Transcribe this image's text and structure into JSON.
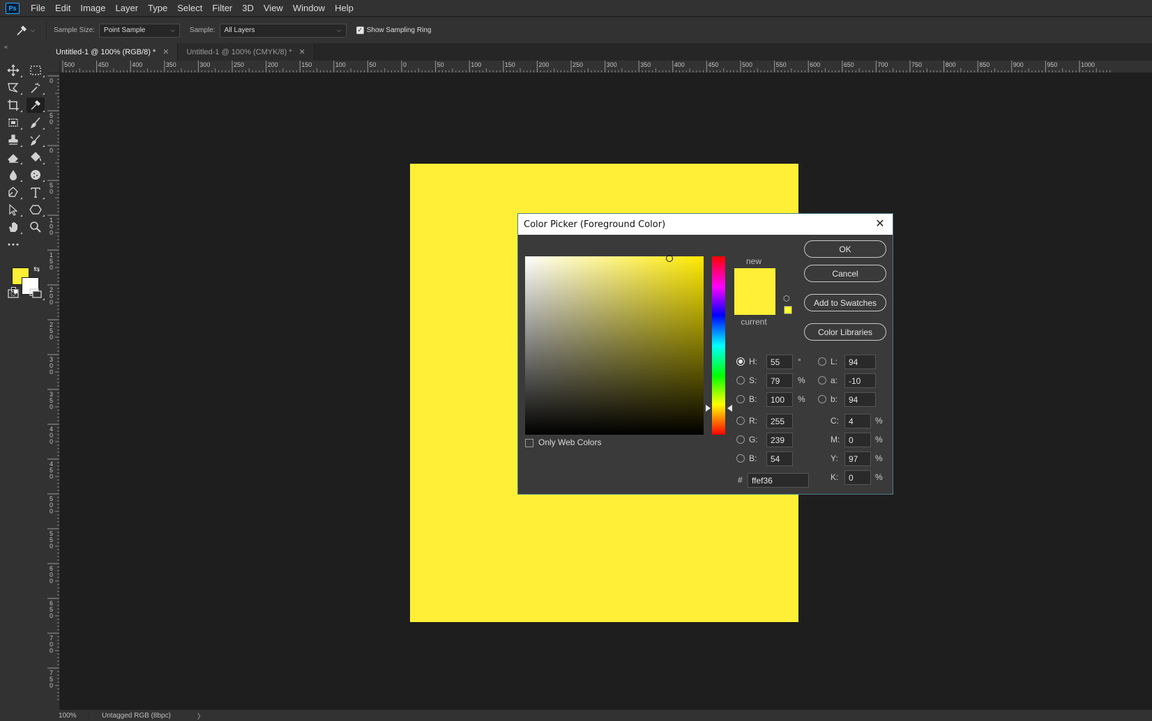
{
  "app": {
    "logo": "Ps"
  },
  "menu": [
    "File",
    "Edit",
    "Image",
    "Layer",
    "Type",
    "Select",
    "Filter",
    "3D",
    "View",
    "Window",
    "Help"
  ],
  "options": {
    "sample_size_label": "Sample Size:",
    "sample_size_value": "Point Sample",
    "sample_label": "Sample:",
    "sample_value": "All Layers",
    "show_ring_label": "Show Sampling Ring",
    "show_ring_checked": true
  },
  "tabs": [
    {
      "label": "Untitled-1 @ 100% (RGB/8) *",
      "active": true
    },
    {
      "label": "Untitled-1 @ 100% (CMYK/8) *",
      "active": false
    }
  ],
  "ruler_top": [
    "500",
    "450",
    "400",
    "350",
    "300",
    "250",
    "200",
    "150",
    "100",
    "50",
    "0",
    "50",
    "100",
    "150",
    "200",
    "250",
    "300",
    "350",
    "400",
    "450",
    "500",
    "550",
    "600",
    "650",
    "700",
    "750",
    "800",
    "850",
    "900",
    "950",
    "1000"
  ],
  "ruler_left": [
    "0",
    "50",
    "0",
    "50",
    "100",
    "150",
    "200",
    "250",
    "300",
    "350",
    "400",
    "450",
    "500",
    "550",
    "600",
    "650",
    "700",
    "750"
  ],
  "status": {
    "zoom": "100%",
    "profile": "Untagged RGB (8bpc)",
    "arrow": "〉"
  },
  "colors": {
    "foreground": "#ffef36",
    "background": "#ffffff",
    "document": "#ffef36",
    "accent": "#31a8ff"
  },
  "dialog": {
    "title": "Color Picker (Foreground Color)",
    "new_label": "new",
    "current_label": "current",
    "new_color": "#ffef36",
    "current_color": "#ffef36",
    "hue_level": 0.15,
    "buttons": {
      "ok": "OK",
      "cancel": "Cancel",
      "add_swatches": "Add to Swatches",
      "libraries": "Color Libraries"
    },
    "only_web_colors": "Only Web Colors",
    "fields": {
      "H": {
        "label": "H:",
        "value": "55",
        "unit": "°",
        "checked": true
      },
      "S": {
        "label": "S:",
        "value": "79",
        "unit": "%"
      },
      "B": {
        "label": "B:",
        "value": "100",
        "unit": "%"
      },
      "R": {
        "label": "R:",
        "value": "255"
      },
      "G": {
        "label": "G:",
        "value": "239"
      },
      "B2": {
        "label": "B:",
        "value": "54"
      },
      "L": {
        "label": "L:",
        "value": "94"
      },
      "a": {
        "label": "a:",
        "value": "-10"
      },
      "b": {
        "label": "b:",
        "value": "94"
      },
      "C": {
        "label": "C:",
        "value": "4",
        "unit": "%"
      },
      "M": {
        "label": "M:",
        "value": "0",
        "unit": "%"
      },
      "Y": {
        "label": "Y:",
        "value": "97",
        "unit": "%"
      },
      "K": {
        "label": "K:",
        "value": "0",
        "unit": "%"
      }
    },
    "hex_label": "#",
    "hex_value": "ffef36"
  }
}
